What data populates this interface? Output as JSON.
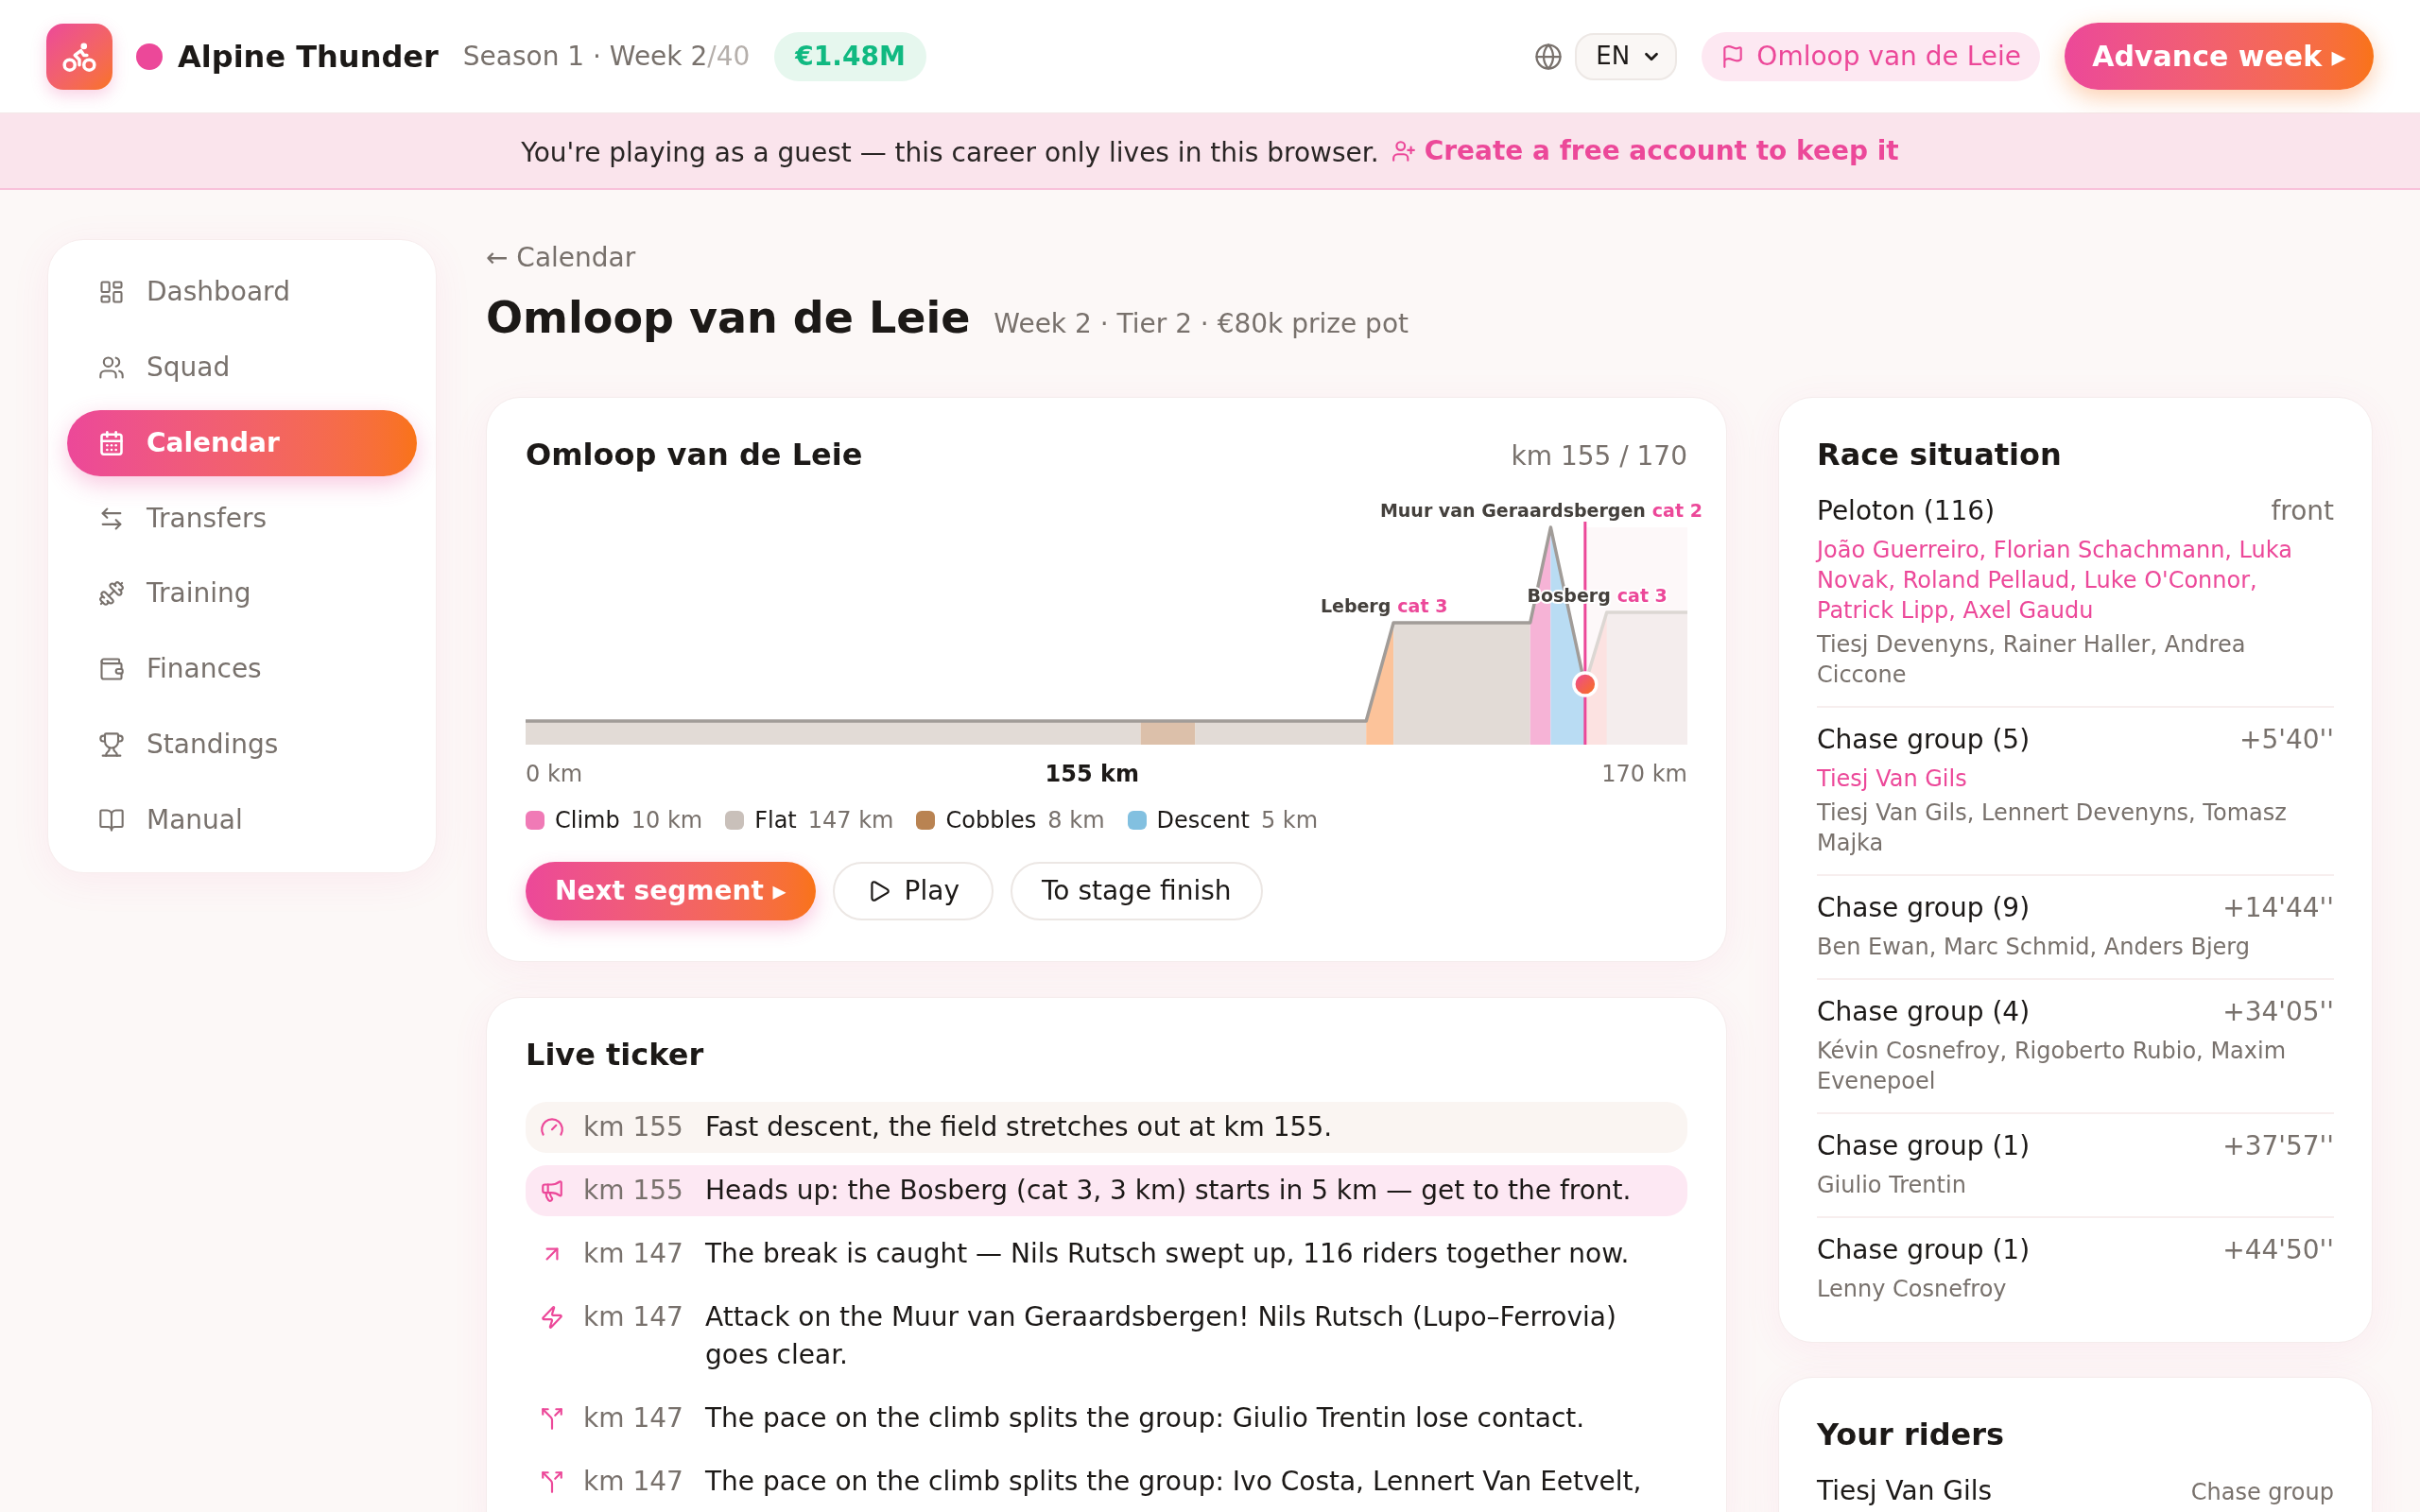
{
  "header": {
    "team": {
      "name": "Alpine Thunder",
      "color": "#ec4899"
    },
    "season": "Season 1 · Week 2",
    "season_total": "/40",
    "budget": "€1.48M",
    "language": "EN",
    "race_link": "Omloop van de Leie",
    "advance_button": "Advance week ▸"
  },
  "guest_banner": {
    "message": "You're playing as a guest — this career only lives in this browser.",
    "link": "Create a free account to keep it"
  },
  "sidebar": {
    "items": [
      {
        "label": "Dashboard",
        "selected": false
      },
      {
        "label": "Squad",
        "selected": false
      },
      {
        "label": "Calendar",
        "selected": true
      },
      {
        "label": "Transfers",
        "selected": false
      },
      {
        "label": "Training",
        "selected": false
      },
      {
        "label": "Finances",
        "selected": false
      },
      {
        "label": "Standings",
        "selected": false
      },
      {
        "label": "Manual",
        "selected": false
      }
    ]
  },
  "page": {
    "back_link": "← Calendar",
    "title": "Omloop van de Leie",
    "subtitle": "Week 2 · Tier 2 · €80k prize pot"
  },
  "profile_card": {
    "title": "Omloop van de Leie",
    "distance": "km 155 / 170",
    "profile": {
      "level": 0.912,
      "climbs": [
        {
          "name": "Leberg",
          "category": "cat 3"
        },
        {
          "name": "Muur van Geraardsbergen",
          "category": "cat 2"
        },
        {
          "name": "Bosberg",
          "category": "cat 3"
        }
      ]
    },
    "axis": {
      "start": "0 km",
      "current": "155 km",
      "end": "170 km"
    },
    "legend": [
      {
        "label": "Climb",
        "value": "10 km",
        "color": "#f07ab6"
      },
      {
        "label": "Flat",
        "value": "147 km",
        "color": "#c9c0ba"
      },
      {
        "label": "Cobbles",
        "value": "8 km",
        "color": "#b98352"
      },
      {
        "label": "Descent",
        "value": "5 km",
        "color": "#82c0e0"
      }
    ],
    "buttons": [
      {
        "kind": "primary",
        "label": "Next segment ▸"
      },
      {
        "kind": "play",
        "label": "Play"
      },
      {
        "kind": "secondary",
        "label": "To stage finish"
      }
    ]
  },
  "live_ticker": {
    "title": "Live ticker",
    "entries": [
      {
        "kind": "speed",
        "km": "km 155",
        "text": "Fast descent, the field stretches out at km 155.",
        "latest": true
      },
      {
        "kind": "alert",
        "km": "km 155",
        "text": "Heads up: the Bosberg (cat 3, 3 km) starts in 5 km — get to the front.",
        "latest": false
      },
      {
        "kind": "catch",
        "km": "km 147",
        "text": "The break is caught — Nils Rutsch swept up, 116 riders together now.",
        "latest": false
      },
      {
        "kind": "attack",
        "km": "km 147",
        "text": "Attack on the Muur van Geraardsbergen! Nils Rutsch (Lupo–Ferrovia) goes clear.",
        "latest": false
      },
      {
        "kind": "split",
        "km": "km 147",
        "text": "The pace on the climb splits the group: Giulio Trentin lose contact.",
        "latest": false
      },
      {
        "kind": "split",
        "km": "km 147",
        "text": "The pace on the climb splits the group: Ivo Costa, Lennert Van Eetvelt,",
        "latest": false
      }
    ]
  },
  "race_situation": {
    "title": "Race situation",
    "groups": [
      {
        "name": "Peloton (116)",
        "gap": "front",
        "own_riders": "João Guerreiro, Florian Schachmann, Luka Novak, Roland Pellaud, Luke O'Connor, Patrick Lipp, Axel Gaudu",
        "riders": "Tiesj Devenyns, Rainer Haller, Andrea Ciccone"
      },
      {
        "name": "Chase group (5)",
        "gap": "+5'40''",
        "own_riders": "Tiesj Van Gils",
        "riders": "Tiesj Van Gils, Lennert Devenyns, Tomasz Majka"
      },
      {
        "name": "Chase group (9)",
        "gap": "+14'44''",
        "riders": "Ben Ewan, Marc Schmid, Anders Bjerg"
      },
      {
        "name": "Chase group (4)",
        "gap": "+34'05''",
        "riders": "Kévin Cosnefroy, Rigoberto Rubio, Maxim Evenepoel"
      },
      {
        "name": "Chase group (1)",
        "gap": "+37'57''",
        "riders": "Giulio Trentin"
      },
      {
        "name": "Chase group (1)",
        "gap": "+44'50''",
        "riders": "Lenny Cosnefroy"
      }
    ]
  },
  "your_riders": {
    "title": "Your riders",
    "riders": [
      {
        "name": "Tiesj Van Gils",
        "group": "Chase group"
      }
    ]
  }
}
